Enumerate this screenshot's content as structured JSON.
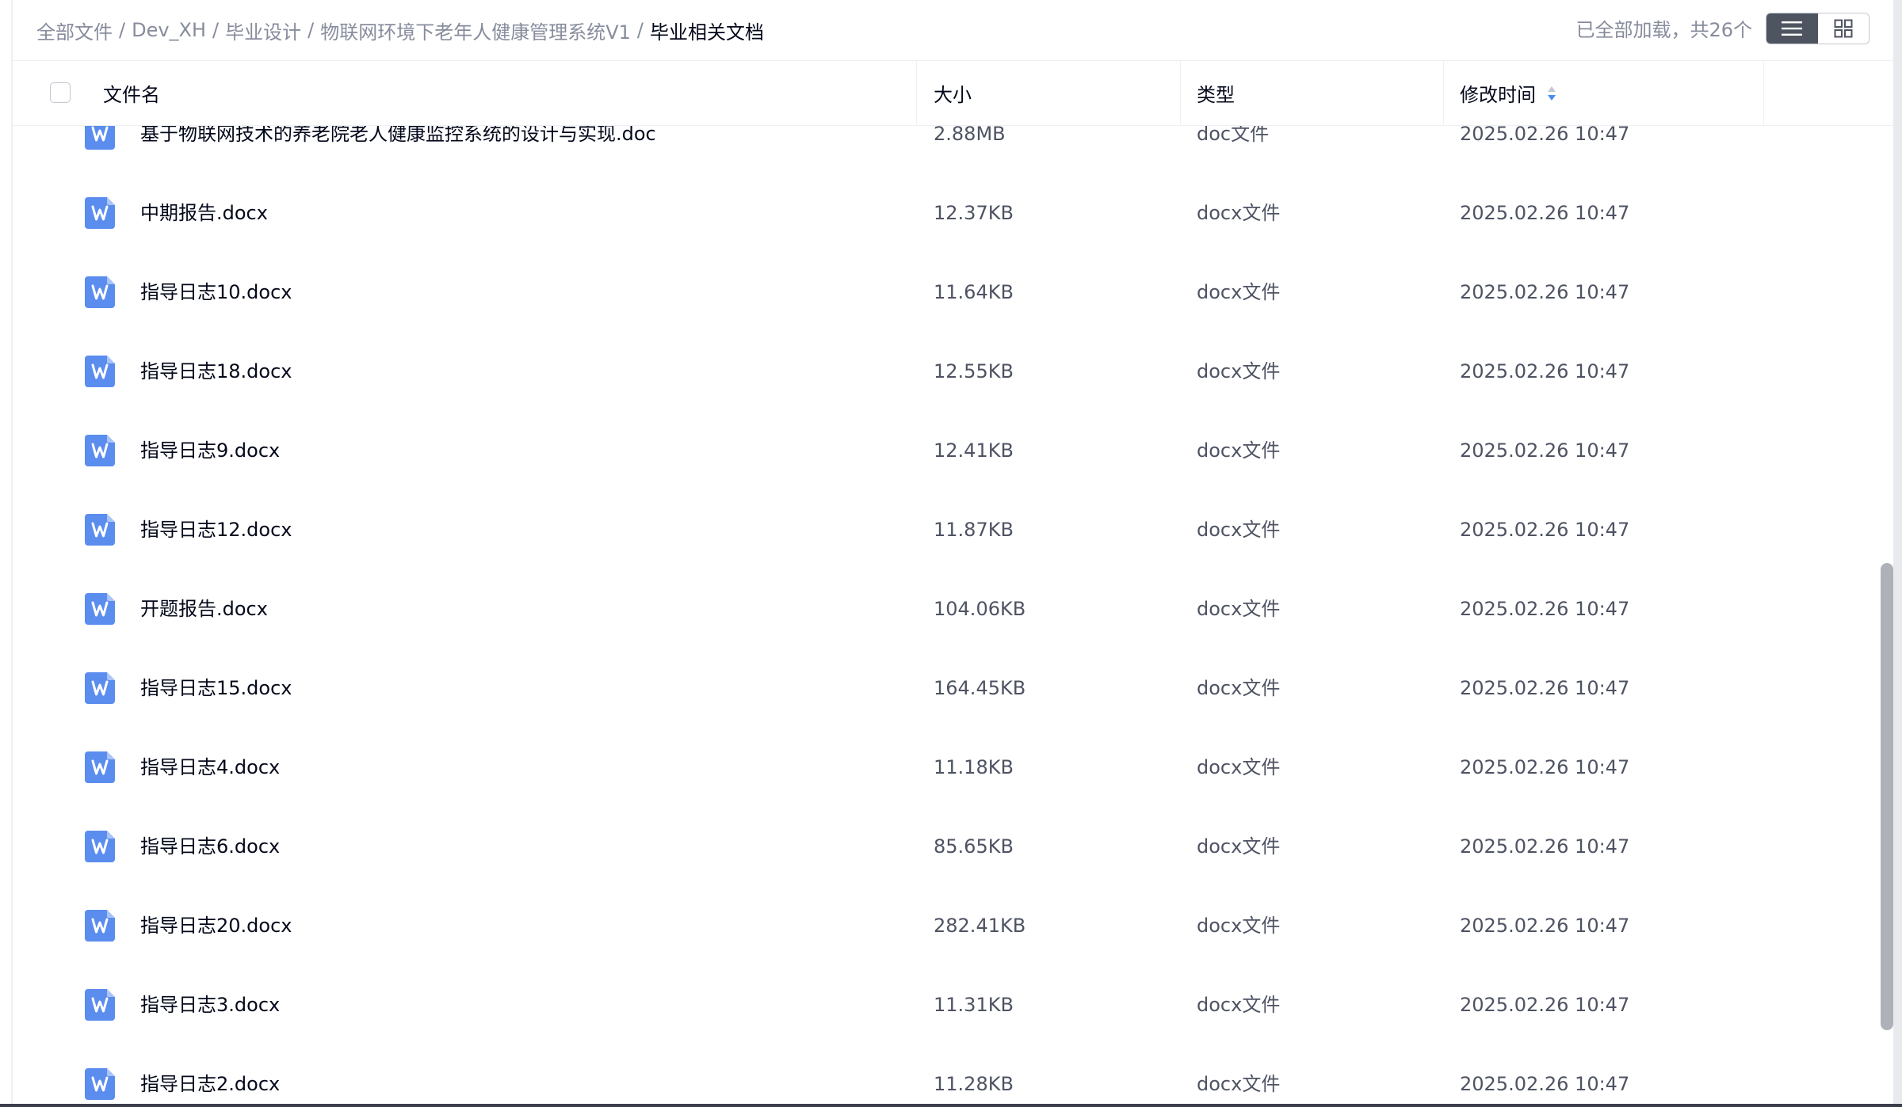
{
  "breadcrumb": {
    "items": [
      "全部文件",
      "Dev_XH",
      "毕业设计",
      "物联网环境下老年人健康管理系统V1"
    ],
    "current": "毕业相关文档",
    "separator": "/"
  },
  "status": {
    "load_text": "已全部加载，共26个"
  },
  "view_toggle": {
    "active": "list",
    "list_icon": "list-view-icon",
    "grid_icon": "grid-view-icon"
  },
  "columns": {
    "name": "文件名",
    "size": "大小",
    "type": "类型",
    "modified": "修改时间"
  },
  "files": [
    {
      "name": "基于物联网技术的养老院老人健康监控系统的设计与实现.doc",
      "size": "2.88MB",
      "type": "doc文件",
      "modified": "2025.02.26 10:47"
    },
    {
      "name": "中期报告.docx",
      "size": "12.37KB",
      "type": "docx文件",
      "modified": "2025.02.26 10:47"
    },
    {
      "name": "指导日志10.docx",
      "size": "11.64KB",
      "type": "docx文件",
      "modified": "2025.02.26 10:47"
    },
    {
      "name": "指导日志18.docx",
      "size": "12.55KB",
      "type": "docx文件",
      "modified": "2025.02.26 10:47"
    },
    {
      "name": "指导日志9.docx",
      "size": "12.41KB",
      "type": "docx文件",
      "modified": "2025.02.26 10:47"
    },
    {
      "name": "指导日志12.docx",
      "size": "11.87KB",
      "type": "docx文件",
      "modified": "2025.02.26 10:47"
    },
    {
      "name": "开题报告.docx",
      "size": "104.06KB",
      "type": "docx文件",
      "modified": "2025.02.26 10:47"
    },
    {
      "name": "指导日志15.docx",
      "size": "164.45KB",
      "type": "docx文件",
      "modified": "2025.02.26 10:47"
    },
    {
      "name": "指导日志4.docx",
      "size": "11.18KB",
      "type": "docx文件",
      "modified": "2025.02.26 10:47"
    },
    {
      "name": "指导日志6.docx",
      "size": "85.65KB",
      "type": "docx文件",
      "modified": "2025.02.26 10:47"
    },
    {
      "name": "指导日志20.docx",
      "size": "282.41KB",
      "type": "docx文件",
      "modified": "2025.02.26 10:47"
    },
    {
      "name": "指导日志3.docx",
      "size": "11.31KB",
      "type": "docx文件",
      "modified": "2025.02.26 10:47"
    },
    {
      "name": "指导日志2.docx",
      "size": "11.28KB",
      "type": "docx文件",
      "modified": "2025.02.26 10:47"
    }
  ],
  "file_icon": "word-document-icon",
  "colors": {
    "icon_blue": "#5b8def",
    "text_primary": "#03081a",
    "text_muted": "#878c9c",
    "toggle_active": "#4f5560",
    "sort_active": "#4a8cf7",
    "sort_inactive": "#c4c7d0"
  }
}
